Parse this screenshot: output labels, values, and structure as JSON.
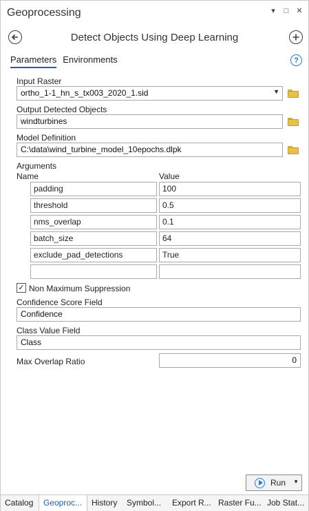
{
  "window": {
    "title": "Geoprocessing",
    "controls": [
      "▾",
      "□",
      "✕"
    ]
  },
  "tool": {
    "title": "Detect Objects Using Deep Learning",
    "back_icon": "back-arrow-icon",
    "add_icon": "add-circle-icon"
  },
  "tabs": [
    {
      "label": "Parameters",
      "active": true
    },
    {
      "label": "Environments",
      "active": false
    }
  ],
  "params": {
    "input_raster": {
      "label": "Input Raster",
      "value": "ortho_1-1_hn_s_tx003_2020_1.sid"
    },
    "output_objects": {
      "label": "Output Detected Objects",
      "value": "windturbines"
    },
    "model_definition": {
      "label": "Model Definition",
      "value": "C:\\data\\wind_turbine_model_10epochs.dlpk"
    },
    "arguments": {
      "label": "Arguments",
      "name_header": "Name",
      "value_header": "Value",
      "rows": [
        {
          "name": "padding",
          "value": "100"
        },
        {
          "name": "threshold",
          "value": "0.5"
        },
        {
          "name": "nms_overlap",
          "value": "0.1"
        },
        {
          "name": "batch_size",
          "value": "64"
        },
        {
          "name": "exclude_pad_detections",
          "value": "True"
        },
        {
          "name": "",
          "value": ""
        }
      ]
    },
    "nms": {
      "label": "Non Maximum Suppression",
      "checked": true,
      "check_glyph": "✓"
    },
    "confidence_field": {
      "label": "Confidence Score Field",
      "value": "Confidence"
    },
    "class_field": {
      "label": "Class Value Field",
      "value": "Class"
    },
    "max_overlap": {
      "label": "Max Overlap Ratio",
      "value": "0"
    }
  },
  "run_button": {
    "label": "Run"
  },
  "bottom_tabs": [
    {
      "label": "Catalog",
      "active": false
    },
    {
      "label": "Geoproc...",
      "active": true
    },
    {
      "label": "History",
      "active": false
    },
    {
      "label": "Symbol...",
      "active": false
    },
    {
      "label": "Export R...",
      "active": false
    },
    {
      "label": "Raster Fu...",
      "active": false
    },
    {
      "label": "Job Stat...",
      "active": false
    }
  ],
  "colors": {
    "accent": "#1a5fb4",
    "folder": "#e6c24d",
    "run_icon": "#2a7ac7"
  }
}
